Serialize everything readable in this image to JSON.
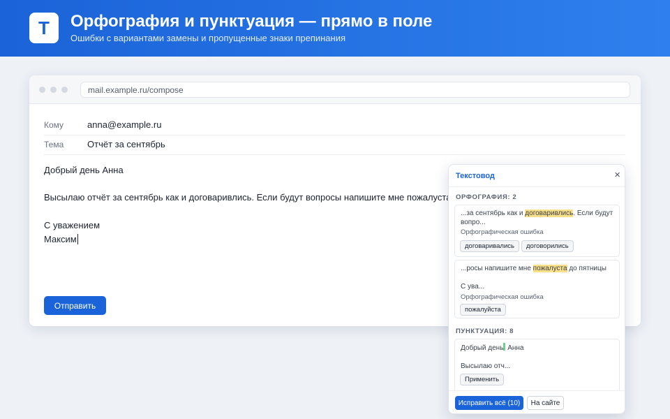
{
  "banner": {
    "logo_letter": "T",
    "title": "Орфография и пунктуация — прямо в поле",
    "subtitle": "Ошибки с вариантами замены и пропущенные знаки препинания"
  },
  "browser": {
    "url": "mail.example.ru/compose"
  },
  "compose": {
    "to_label": "Кому",
    "to_value": "anna@example.ru",
    "subject_label": "Тема",
    "subject_value": "Отчёт за сентябрь",
    "body_lines": [
      "Добрый день Анна",
      "Высылаю отчёт за сентябрь как и договаривлись. Если будут вопросы напишите мне пожалуста д",
      "С уважением",
      "Максим"
    ],
    "send_label": "Отправить"
  },
  "panel": {
    "title": "Текстовод",
    "close_glyph": "×",
    "spelling_title": "ОРФОГРАФИЯ: 2",
    "spelling_items": [
      {
        "pre": "...за сентябрь как и ",
        "error": "договаривлись",
        "post": ". Если будут вопро...",
        "kind": "Орфографическая ошибка",
        "suggestions": [
          "договаривались",
          "договорились"
        ]
      },
      {
        "pre": "...росы напишите мне ",
        "error": "пожалуста",
        "post": " до пятницы",
        "post2": "С ува...",
        "kind": "Орфографическая ошибка",
        "suggestions": [
          "пожалуйста"
        ]
      }
    ],
    "punct_title": "ПУНКТУАЦИЯ: 8",
    "punct_items": [
      {
        "pre": "Добрый день",
        "post": " Анна",
        "post2": "Высылаю отч...",
        "apply_label": "Применить"
      }
    ],
    "fix_all_label": "Исправить всё (10)",
    "on_site_label": "На сайте"
  },
  "colors": {
    "accent": "#1a63d8",
    "spelling_highlight": "#fbe08a",
    "punct_marker": "#6ad28a"
  }
}
